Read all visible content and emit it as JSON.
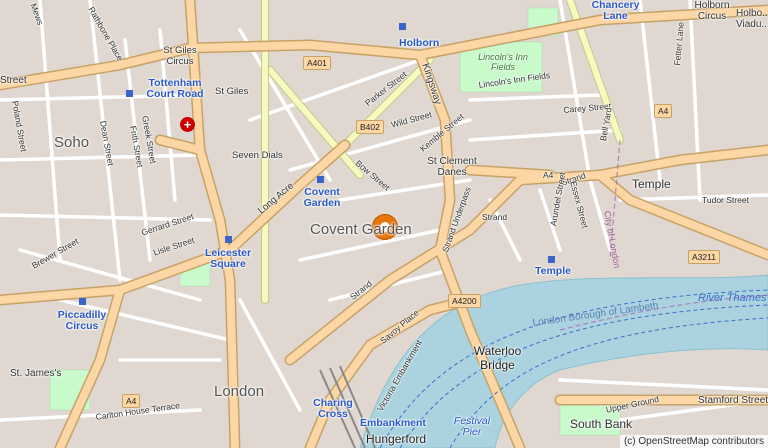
{
  "map": {
    "area_labels": {
      "soho": "Soho",
      "covent_garden": "Covent Garden",
      "london": "London",
      "temple": "Temple",
      "south_bank": "South Bank"
    },
    "stations": {
      "tottenham_court_road": "Tottenham Court Road",
      "holborn": "Holborn",
      "chancery_lane": "Chancery Lane",
      "holborn_circus": "Holborn Circus",
      "holborn_viaduct": "Holbo... Viadu...",
      "covent_garden": "Covent Garden",
      "leicester_square": "Leicester Square",
      "piccadilly_circus": "Piccadilly Circus",
      "charing_cross": "Charing Cross",
      "embankment": "Embankment",
      "temple": "Temple",
      "waterloo_bridge": "Waterloo Bridge",
      "hungerford": "Hungerford",
      "festival_pier": "Festival Pier"
    },
    "road_labels": {
      "street_left": "Street",
      "st_giles_circus": "St Giles Circus",
      "st_giles": "St Giles",
      "seven_dials": "Seven Dials",
      "long_acre": "Long Acre",
      "parker_street": "Parker Street",
      "wild_street": "Wild Street",
      "kemble_street": "Kemble Street",
      "bow_street": "Bow Street",
      "kingsway": "Kingsway",
      "lincolns_inn_fields_road": "Lincoln's Inn Fields",
      "st_clement_danes": "St Clement Danes",
      "strand_upper": "Strand",
      "strand_mid": "Strand",
      "strand_lower": "Strand",
      "strand_underpass": "Strand Underpass",
      "arundel_street": "Arundel Street",
      "essex_street": "Essex Street",
      "tudor_street": "Tudor Street",
      "carey_street": "Carey Street",
      "bell_yard": "Bell Yard",
      "fetter_lane": "Fetter Lane",
      "dean_street": "Dean Street",
      "greek_street": "Greek Street",
      "frith_street": "Frith Street",
      "poland_street": "Poland Street",
      "gerrard_street": "Gerrard Street",
      "lisle_street": "Lisle Street",
      "brewer_street": "Brewer Street",
      "savoy_place": "Savoy Place",
      "victoria_embankment": "Victoria Embankment",
      "st_james": "St. James's",
      "carlton_house_terrace": "Carlton House Terrace",
      "upper_ground": "Upper Ground",
      "stamford_street": "Stamford Street",
      "rathbone_place": "Rathbone Place",
      "mews": "Mews"
    },
    "road_refs": {
      "a401": "A401",
      "b402": "B402",
      "a4_west": "A4",
      "a4_east": "A4",
      "a4_lower": "A4",
      "a4200": "A4200",
      "a3211": "A3211"
    },
    "water_labels": {
      "river_thames": "River Thames",
      "borough": "London Borough of Lambeth",
      "city_of_london": "City of London"
    },
    "park_labels": {
      "lincolns_inn_fields": "Lincoln's Inn Fields"
    },
    "attribution": "(c) OpenStreetMap contributors",
    "colors": {
      "land": "#f2efe9",
      "buildings": "#d9d0c9",
      "major_road": "#fcd6a4",
      "secondary_road": "#f7fabf",
      "minor_road": "#ffffff",
      "water": "#aad3df",
      "park": "#c8facc",
      "rail": "#999999",
      "marker": "#e8740c"
    }
  }
}
